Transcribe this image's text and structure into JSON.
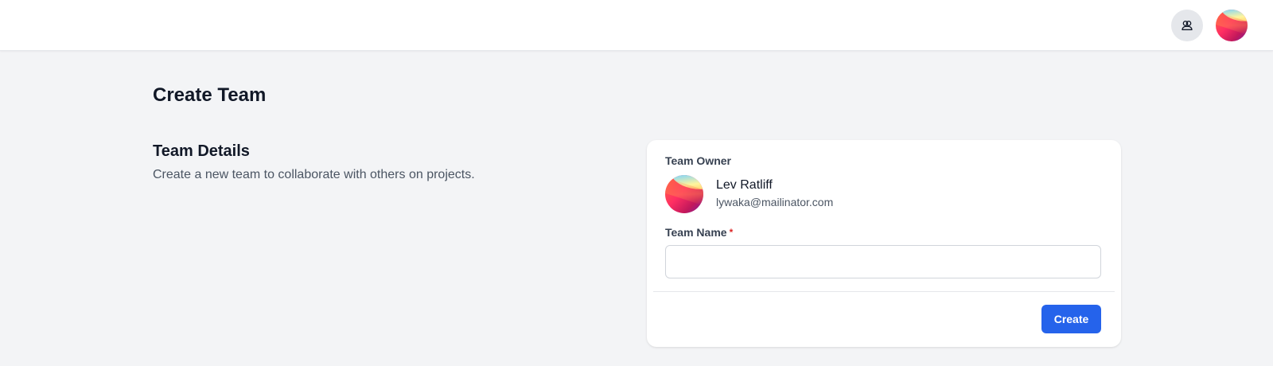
{
  "header": {
    "team_switch_icon": "users-icon",
    "user_avatar": "avatar-gradient"
  },
  "page": {
    "title": "Create Team"
  },
  "section": {
    "title": "Team Details",
    "description": "Create a new team to collaborate with others on projects."
  },
  "form": {
    "owner_label": "Team Owner",
    "owner_name": "Lev Ratliff",
    "owner_email": "lywaka@mailinator.com",
    "team_name_label": "Team Name",
    "required_marker": "*",
    "team_name_value": "",
    "create_label": "Create"
  },
  "colors": {
    "accent": "#2563eb",
    "page_background": "#f3f4f6",
    "required": "#dc2626"
  }
}
